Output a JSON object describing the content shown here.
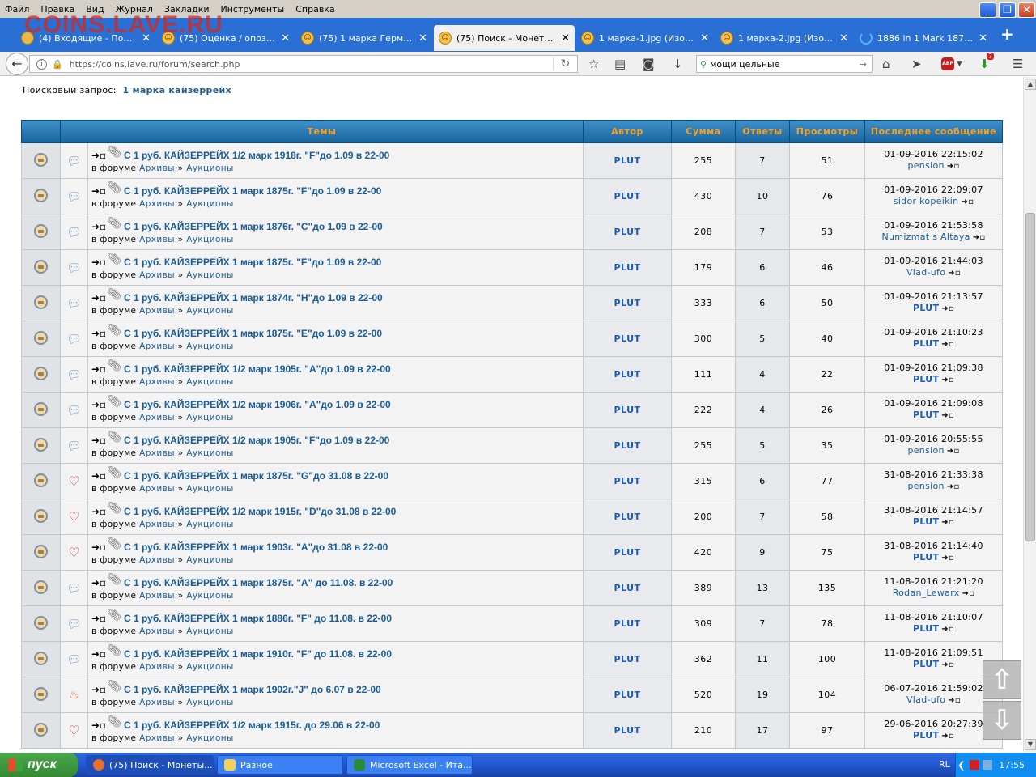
{
  "menu": [
    "Файл",
    "Правка",
    "Вид",
    "Журнал",
    "Закладки",
    "Инструменты",
    "Справка"
  ],
  "watermark": "COINS.LAVE.RU",
  "tabs": [
    {
      "label": "(4) Входящие - Почт...",
      "icon": "mail-icon"
    },
    {
      "label": "(75) Оценка / опозна...",
      "icon": "smiley-icon"
    },
    {
      "label": "(75) 1 марка Герман...",
      "icon": "smiley-icon"
    },
    {
      "label": "(75) Поиск - Монеты ...",
      "icon": "smiley-icon",
      "active": true
    },
    {
      "label": "1 марка-1.jpg (Изобр...",
      "icon": "smiley-icon"
    },
    {
      "label": "1 марка-2.jpg (Изобр...",
      "icon": "smiley-icon"
    },
    {
      "label": "1886 in 1 Mark 1873-...",
      "icon": "loading-icon"
    }
  ],
  "nav": {
    "url": "https://coins.lave.ru/forum/search.php",
    "search_value": "мощи цельные",
    "downloads_badge": "7",
    "abp_label": "ABP"
  },
  "query": {
    "label": "Поисковый запрос:",
    "value": "1 марка кайзеррейх"
  },
  "table": {
    "headers": [
      "Темы",
      "Автор",
      "Сумма",
      "Ответы",
      "Просмотры",
      "Последнее сообщение"
    ],
    "forum_prefix": "в форуме",
    "forum_1": "Архивы",
    "forum_sep": "»",
    "forum_2": "Аукционы",
    "rows": [
      {
        "type": "bubble",
        "title": "С 1 руб. КАЙЗЕРРЕЙХ 1/2 марк 1918г. \"F\"до 1.09 в 22-00",
        "author": "PLUT",
        "sum": "255",
        "replies": "7",
        "views": "51",
        "date": "01-09-2016 22:15:02",
        "last": "pension",
        "last_bold": false
      },
      {
        "type": "bubble",
        "title": "С 1 руб. КАЙЗЕРРЕЙХ 1 марк 1875г. \"F\"до 1.09 в 22-00",
        "author": "PLUT",
        "sum": "430",
        "replies": "10",
        "views": "76",
        "date": "01-09-2016 22:09:07",
        "last": "sidor kopeikin",
        "last_bold": false
      },
      {
        "type": "bubble",
        "title": "С 1 руб. КАЙЗЕРРЕЙХ 1 марк 1876г. \"С\"до 1.09 в 22-00",
        "author": "PLUT",
        "sum": "208",
        "replies": "7",
        "views": "53",
        "date": "01-09-2016 21:53:58",
        "last": "Numizmat s Altaya",
        "last_bold": false
      },
      {
        "type": "bubble",
        "title": "С 1 руб. КАЙЗЕРРЕЙХ 1 марк 1875г. \"F\"до 1.09 в 22-00",
        "author": "PLUT",
        "sum": "179",
        "replies": "6",
        "views": "46",
        "date": "01-09-2016 21:44:03",
        "last": "Vlad-ufo",
        "last_bold": false
      },
      {
        "type": "bubble",
        "title": "С 1 руб. КАЙЗЕРРЕЙХ 1 марк 1874г. \"Н\"до 1.09 в 22-00",
        "author": "PLUT",
        "sum": "333",
        "replies": "6",
        "views": "50",
        "date": "01-09-2016 21:13:57",
        "last": "PLUT",
        "last_bold": true
      },
      {
        "type": "bubble",
        "title": "С 1 руб. КАЙЗЕРРЕЙХ 1 марк 1875г. \"Е\"до 1.09 в 22-00",
        "author": "PLUT",
        "sum": "300",
        "replies": "5",
        "views": "40",
        "date": "01-09-2016 21:10:23",
        "last": "PLUT",
        "last_bold": true
      },
      {
        "type": "bubble",
        "title": "С 1 руб. КАЙЗЕРРЕЙХ 1/2 марк 1905г. \"А\"до 1.09 в 22-00",
        "author": "PLUT",
        "sum": "111",
        "replies": "4",
        "views": "22",
        "date": "01-09-2016 21:09:38",
        "last": "PLUT",
        "last_bold": true
      },
      {
        "type": "bubble",
        "title": "С 1 руб. КАЙЗЕРРЕЙХ 1/2 марк 1906г. \"А\"до 1.09 в 22-00",
        "author": "PLUT",
        "sum": "222",
        "replies": "4",
        "views": "26",
        "date": "01-09-2016 21:09:08",
        "last": "PLUT",
        "last_bold": true
      },
      {
        "type": "bubble",
        "title": "С 1 руб. КАЙЗЕРРЕЙХ 1/2 марк 1905г. \"F\"до 1.09 в 22-00",
        "author": "PLUT",
        "sum": "255",
        "replies": "5",
        "views": "35",
        "date": "01-09-2016 20:55:55",
        "last": "pension",
        "last_bold": false
      },
      {
        "type": "heart",
        "title": "С 1 руб. КАЙЗЕРРЕЙХ 1 марк 1875г. \"G\"до 31.08 в 22-00",
        "author": "PLUT",
        "sum": "315",
        "replies": "6",
        "views": "77",
        "date": "31-08-2016 21:33:38",
        "last": "pension",
        "last_bold": false
      },
      {
        "type": "heart",
        "title": "С 1 руб. КАЙЗЕРРЕЙХ 1/2 марк 1915г. \"D\"до 31.08 в 22-00",
        "author": "PLUT",
        "sum": "200",
        "replies": "7",
        "views": "58",
        "date": "31-08-2016 21:14:57",
        "last": "PLUT",
        "last_bold": true
      },
      {
        "type": "heart",
        "title": "С 1 руб. КАЙЗЕРРЕЙХ 1 марк 1903г. \"А\"до 31.08 в 22-00",
        "author": "PLUT",
        "sum": "420",
        "replies": "9",
        "views": "75",
        "date": "31-08-2016 21:14:40",
        "last": "PLUT",
        "last_bold": true
      },
      {
        "type": "bubble",
        "title": "С 1 руб. КАЙЗЕРРЕЙХ 1 марк 1875г. \"А\" до 11.08. в 22-00",
        "author": "PLUT",
        "sum": "389",
        "replies": "13",
        "views": "135",
        "date": "11-08-2016 21:21:20",
        "last": "Rodan_Lewarx",
        "last_bold": false
      },
      {
        "type": "bubble",
        "title": "С 1 руб. КАЙЗЕРРЕЙХ 1 марк 1886г. \"F\" до 11.08. в 22-00",
        "author": "PLUT",
        "sum": "309",
        "replies": "7",
        "views": "78",
        "date": "11-08-2016 21:10:07",
        "last": "PLUT",
        "last_bold": true
      },
      {
        "type": "bubble",
        "title": "С 1 руб. КАЙЗЕРРЕЙХ 1 марк 1910г. \"F\" до 11.08. в 22-00",
        "author": "PLUT",
        "sum": "362",
        "replies": "11",
        "views": "100",
        "date": "11-08-2016 21:09:51",
        "last": "PLUT",
        "last_bold": true
      },
      {
        "type": "fire",
        "title": "С 1 руб. КАЙЗЕРРЕЙХ 1 марк 1902г.\"J\" до 6.07 в 22-00",
        "author": "PLUT",
        "sum": "520",
        "replies": "19",
        "views": "104",
        "date": "06-07-2016 21:59:02",
        "last": "Vlad-ufo",
        "last_bold": false
      },
      {
        "type": "heart",
        "title": "С 1 руб. КАЙЗЕРРЕЙХ 1/2 марк 1915г. до 29.06 в 22-00",
        "author": "PLUT",
        "sum": "210",
        "replies": "17",
        "views": "97",
        "date": "29-06-2016 20:27:39",
        "last": "PLUT",
        "last_bold": true
      }
    ]
  },
  "taskbar": {
    "start": "пуск",
    "items": [
      "(75) Поиск - Монеты...",
      "Разное",
      "Microsoft Excel - Ита..."
    ],
    "lang": "RL",
    "clock": "17:55"
  }
}
